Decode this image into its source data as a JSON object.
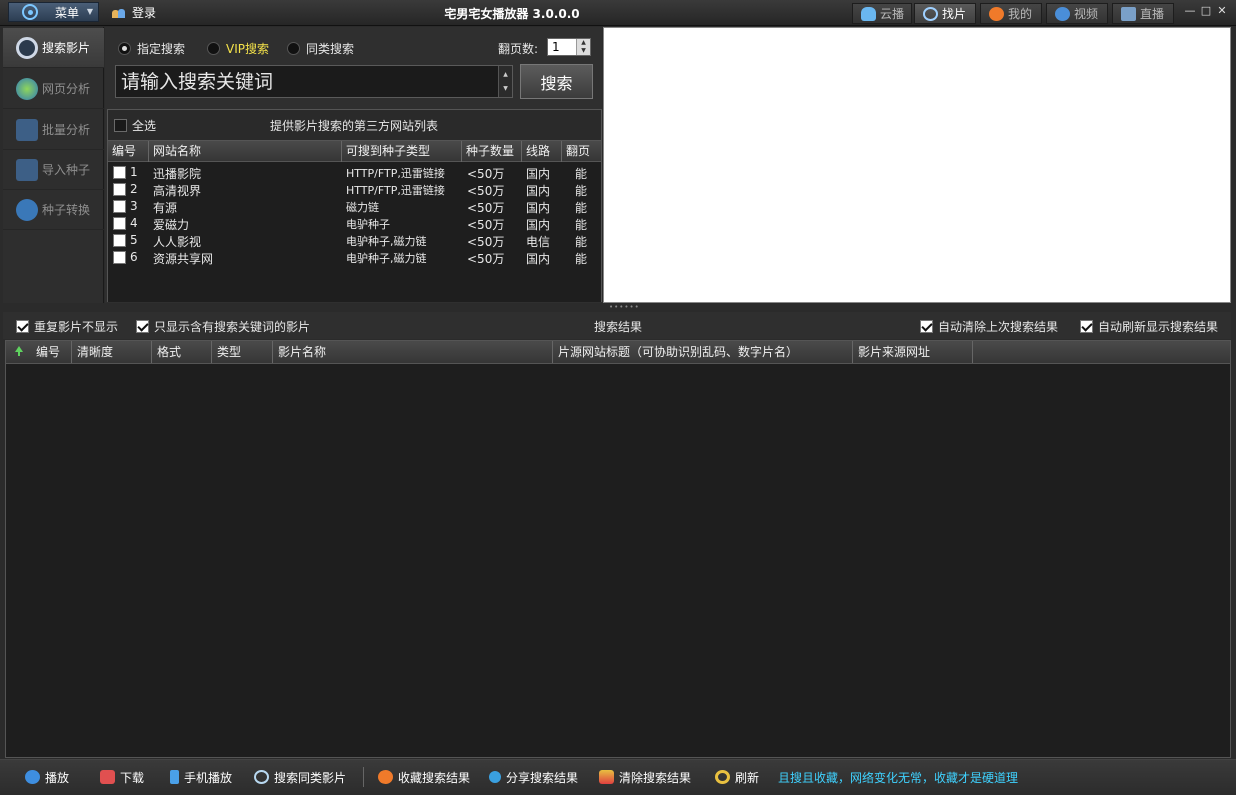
{
  "titlebar": {
    "menu_label": "菜单",
    "login_label": "登录",
    "app_title": "宅男宅女播放器 3.0.0.0",
    "tabs": [
      {
        "label": "云播",
        "active": false
      },
      {
        "label": "找片",
        "active": true
      },
      {
        "label": "我的",
        "active": false
      },
      {
        "label": "视频",
        "active": false
      },
      {
        "label": "直播",
        "active": false
      }
    ]
  },
  "leftnav": {
    "items": [
      {
        "label": "搜索影片",
        "active": true,
        "icon": "search-film-icon"
      },
      {
        "label": "网页分析",
        "active": false,
        "icon": "globe-icon"
      },
      {
        "label": "批量分析",
        "active": false,
        "icon": "batch-icon"
      },
      {
        "label": "导入种子",
        "active": false,
        "icon": "import-icon"
      },
      {
        "label": "种子转换",
        "active": false,
        "icon": "convert-icon"
      }
    ]
  },
  "search": {
    "modes": [
      {
        "label": "指定搜索",
        "checked": true
      },
      {
        "label": "VIP搜索",
        "checked": false
      },
      {
        "label": "同类搜索",
        "checked": false
      }
    ],
    "pages_label": "翻页数:",
    "pages_value": "1",
    "keyword_placeholder": "请输入搜索关键词",
    "search_button": "搜索"
  },
  "sites": {
    "select_all": "全选",
    "title": "提供影片搜索的第三方网站列表",
    "columns": [
      "编号",
      "网站名称",
      "可搜到种子类型",
      "种子数量",
      "线路",
      "翻页"
    ],
    "rows": [
      {
        "num": "1",
        "name": "迅播影院",
        "type": "HTTP/FTP,迅雷链接",
        "count": "<50万",
        "line": "国内",
        "page": "能"
      },
      {
        "num": "2",
        "name": "高清视界",
        "type": "HTTP/FTP,迅雷链接",
        "count": "<50万",
        "line": "国内",
        "page": "能"
      },
      {
        "num": "3",
        "name": "有源",
        "type": "磁力链",
        "count": "<50万",
        "line": "国内",
        "page": "能"
      },
      {
        "num": "4",
        "name": "爱磁力",
        "type": "电驴种子",
        "count": "<50万",
        "line": "国内",
        "page": "能"
      },
      {
        "num": "5",
        "name": "人人影视",
        "type": "电驴种子,磁力链",
        "count": "<50万",
        "line": "电信",
        "page": "能"
      },
      {
        "num": "6",
        "name": "资源共享网",
        "type": "电驴种子,磁力链",
        "count": "<50万",
        "line": "国内",
        "page": "能"
      }
    ]
  },
  "options": {
    "hide_duplicates": "重复影片不显示",
    "only_keyword": "只显示含有搜索关键词的影片",
    "results_title": "搜索结果",
    "auto_clear": "自动清除上次搜索结果",
    "auto_refresh": "自动刷新显示搜索结果"
  },
  "results": {
    "columns": [
      "编号",
      "清晰度",
      "格式",
      "类型",
      "影片名称",
      "片源网站标题（可协助识别乱码、数字片名）",
      "影片来源网址"
    ]
  },
  "bottom": {
    "buttons": [
      {
        "label": "播放",
        "icon": "play-icon"
      },
      {
        "label": "下载",
        "icon": "download-icon"
      },
      {
        "label": "手机播放",
        "icon": "phone-icon"
      },
      {
        "label": "搜索同类影片",
        "icon": "search-similar-icon"
      },
      {
        "label": "收藏搜索结果",
        "icon": "heart-icon"
      },
      {
        "label": "分享搜索结果",
        "icon": "share-icon"
      },
      {
        "label": "清除搜索结果",
        "icon": "clear-icon"
      },
      {
        "label": "刷新",
        "icon": "refresh-icon"
      }
    ],
    "slogan": "且搜且收藏，网络变化无常，收藏才是硬道理"
  },
  "colors": {
    "accent_blue": "#3fd2ff",
    "vip_yellow": "#f5e34a",
    "background": "#2b2b2b"
  }
}
